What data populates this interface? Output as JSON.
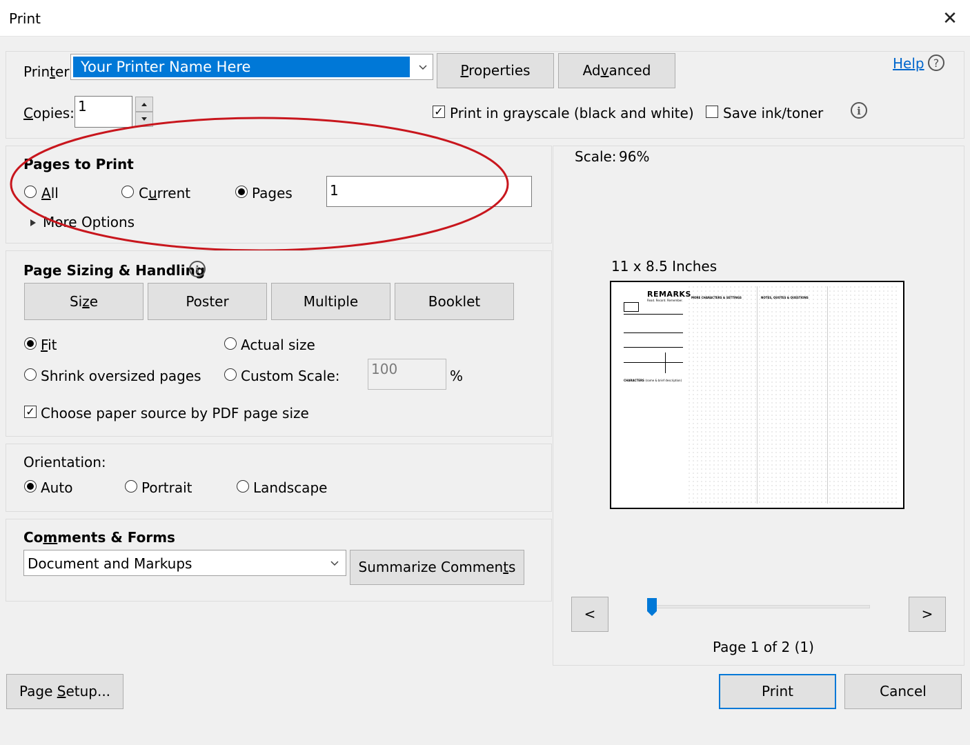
{
  "window": {
    "title": "Print",
    "close_glyph": "✕"
  },
  "printer": {
    "label": "Printer:",
    "value": "Your Printer Name Here",
    "properties_button": "Properties",
    "advanced_button": "Advanced",
    "help_link": "Help",
    "copies_label": "Copies:",
    "copies_value": "1",
    "grayscale_label": "Print in grayscale (black and white)",
    "grayscale_checked": true,
    "save_ink_label": "Save ink/toner",
    "save_ink_checked": false
  },
  "pages_to_print": {
    "heading": "Pages to Print",
    "options": [
      "All",
      "Current",
      "Pages"
    ],
    "selected": "Pages",
    "pages_value": "1",
    "more_options": "More Options"
  },
  "page_sizing": {
    "heading": "Page Sizing & Handling",
    "tabs": [
      "Size",
      "Poster",
      "Multiple",
      "Booklet"
    ],
    "fit": "Fit",
    "actual_size": "Actual size",
    "shrink": "Shrink oversized pages",
    "custom_scale": "Custom Scale:",
    "custom_scale_value": "100",
    "percent": "%",
    "selected": "Fit",
    "paper_source_label": "Choose paper source by PDF page size",
    "paper_source_checked": true
  },
  "orientation": {
    "heading": "Orientation:",
    "options": [
      "Auto",
      "Portrait",
      "Landscape"
    ],
    "selected": "Auto"
  },
  "comments_forms": {
    "heading": "Comments & Forms",
    "value": "Document and Markups",
    "summarize_button": "Summarize Comments"
  },
  "preview": {
    "scale_label": "Scale:",
    "scale_value": "96%",
    "paper_size": "11 x 8.5 Inches",
    "doc_title": "REMARKS",
    "doc_tagline": "Read. Record. Remember.",
    "doc_col2": "MORE CHARACTERS & SETTINGS",
    "doc_col3": "NOTES, QUOTES & QUESTIONS",
    "doc_characters": "CHARACTERS",
    "doc_characters_note": "(name & brief description)",
    "prev_button": "<",
    "next_button": ">",
    "page_status": "Page 1 of 2 (1)",
    "slider_position": 0
  },
  "footer": {
    "page_setup": "Page Setup...",
    "print": "Print",
    "cancel": "Cancel"
  },
  "colors": {
    "accent": "#0078d7",
    "annotation_circle": "#c8161d"
  }
}
